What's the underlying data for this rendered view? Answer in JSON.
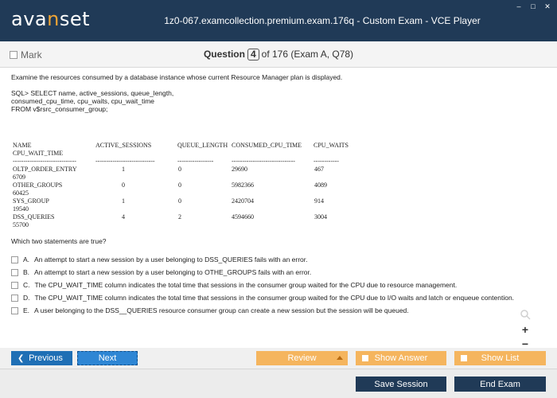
{
  "app": {
    "logo_pre": "ava",
    "logo_accent": "n",
    "logo_post": "set",
    "title": "1z0-067.examcollection.premium.exam.176q - Custom Exam - VCE Player",
    "win_min": "–",
    "win_max": "□",
    "win_close": "✕"
  },
  "qbar": {
    "mark_label": "Mark",
    "question_label": "Question",
    "question_number": "4",
    "of_text": "of 176 (Exam A, Q78)"
  },
  "content": {
    "intro": "Examine the resources consumed by a database instance whose current Resource Manager plan is displayed.",
    "sql": [
      "SQL> SELECT name, active_sessions, queue_length,",
      "consumed_cpu_time, cpu_waits, cpu_wait_time",
      "FROM v$rsrc_consumer_group;"
    ]
  },
  "table": {
    "headers": [
      "NAME",
      "ACTIVE_SESSIONS",
      "QUEUE_LENGTH",
      "CONSUMED_CPU_TIME",
      "CPU_WAITS"
    ],
    "header2": "CPU_WAIT_TIME",
    "separators": [
      "------------------------------",
      "----------------------------",
      "-----------------",
      "------------------------------",
      "------------"
    ],
    "rows": [
      {
        "name": "OLTP_ORDER_ENTRY",
        "active": "1",
        "queue": "0",
        "cpu": "29690",
        "waits": "467",
        "wait_time": "6709"
      },
      {
        "name": "OTHER_GROUPS",
        "active": "0",
        "queue": "0",
        "cpu": "5982366",
        "waits": "4089",
        "wait_time": "60425"
      },
      {
        "name": "SYS_GROUP",
        "active": "1",
        "queue": "0",
        "cpu": "2420704",
        "waits": "914",
        "wait_time": "19540"
      },
      {
        "name": "DSS_QUERIES",
        "active": "4",
        "queue": "2",
        "cpu": "4594660",
        "waits": "3004",
        "wait_time": "55700"
      }
    ]
  },
  "question": "Which two statements are true?",
  "options": [
    {
      "letter": "A.",
      "text": "An attempt to start a new session by a user belonging to DSS_QUERIES fails with an error."
    },
    {
      "letter": "B.",
      "text": "An attempt to start a new session by a user belonging to OTHE_GROUPS fails with an error."
    },
    {
      "letter": "C.",
      "text": "The CPU_WAIT_TIME column indicates the total time that sessions in the consumer group waited for the CPU due to resource management."
    },
    {
      "letter": "D.",
      "text": "The CPU_WAIT_TIME column indicates the total time that sessions in the consumer group waited for the CPU due to I/O waits and latch or enqueue contention."
    },
    {
      "letter": "E.",
      "text": "A user belonging to the DSS__QUERIES resource consumer group can create a new session but the session will be queued."
    }
  ],
  "zoom": {
    "in": "+",
    "out": "−"
  },
  "nav": {
    "previous": "Previous",
    "next": "Next",
    "review": "Review",
    "show_answer": "Show Answer",
    "show_list": "Show List"
  },
  "footer": {
    "save_session": "Save Session",
    "end_exam": "End Exam"
  }
}
